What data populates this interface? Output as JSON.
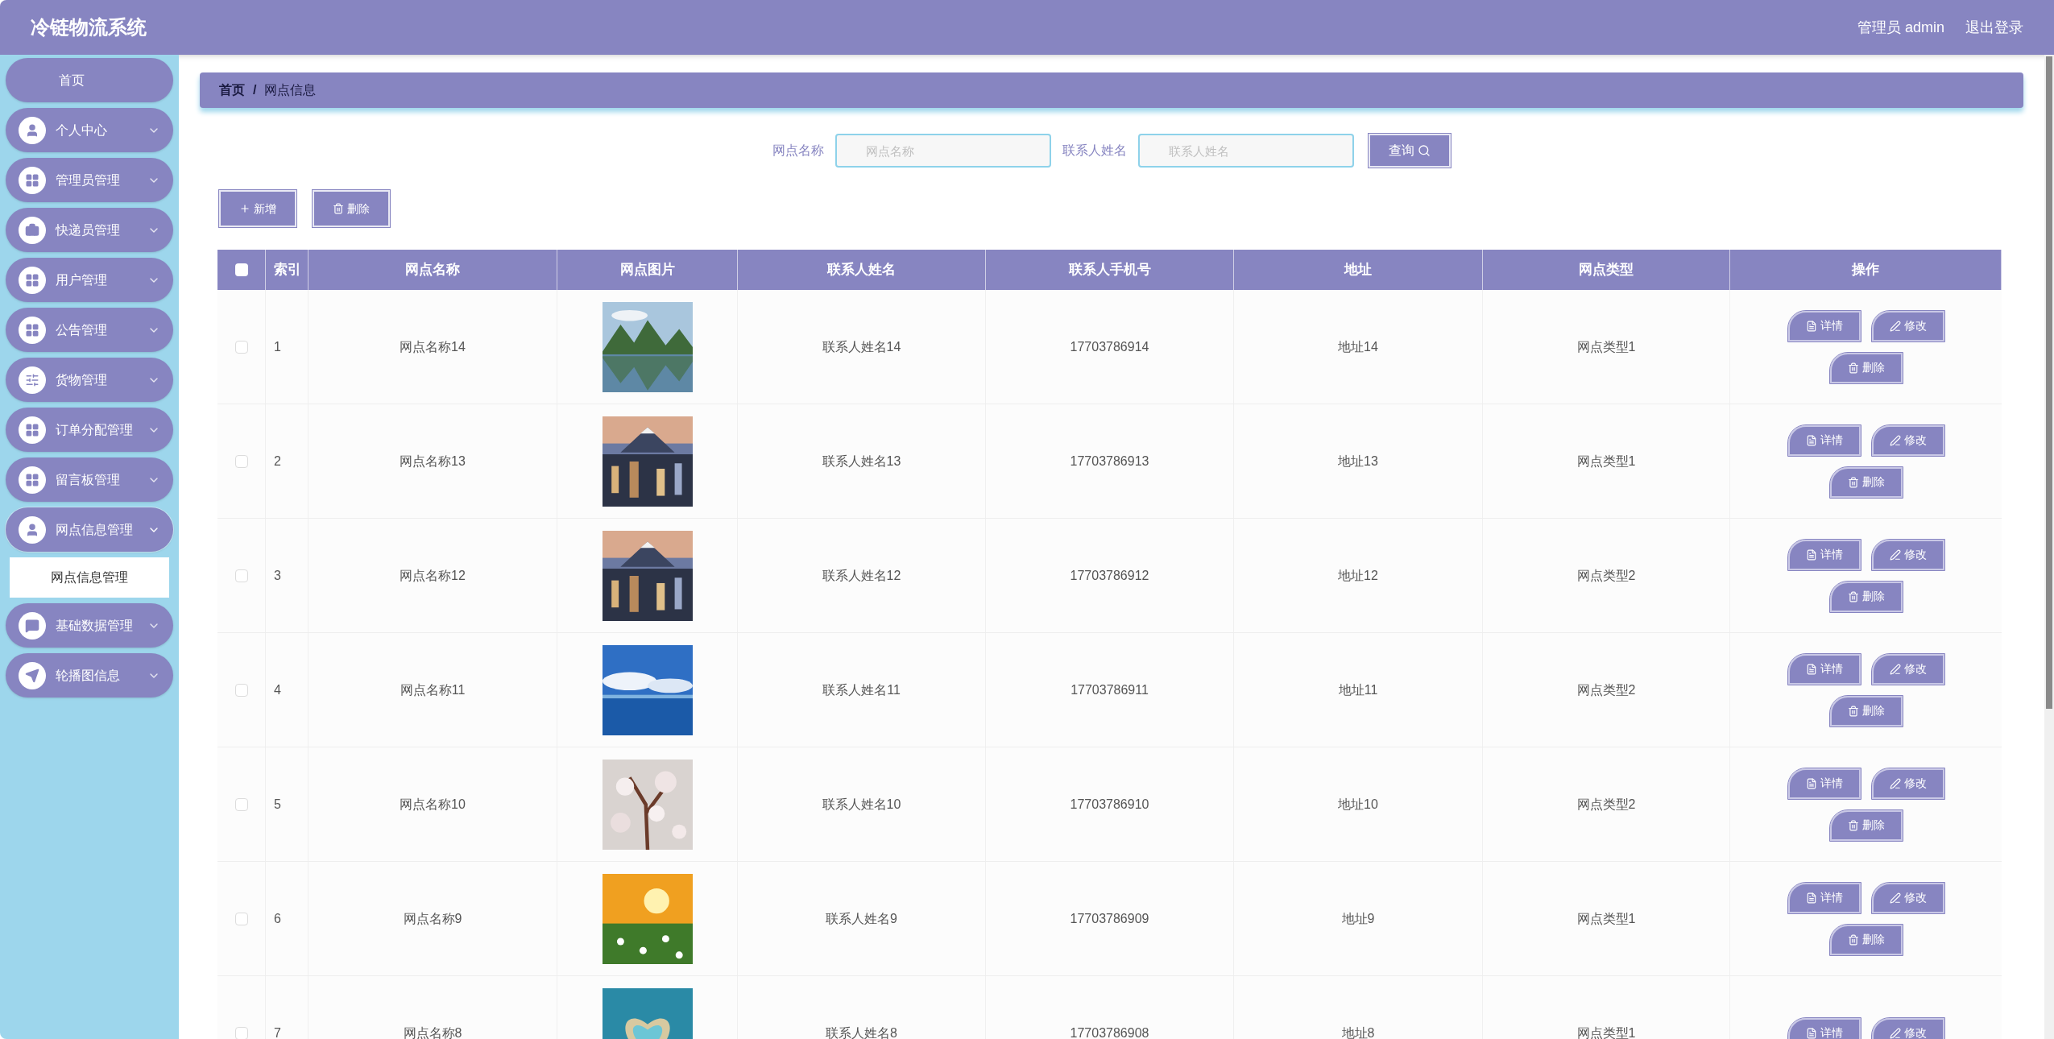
{
  "header": {
    "title": "冷链物流系统",
    "user": "管理员 admin",
    "logout": "退出登录"
  },
  "sidebar": {
    "items": [
      {
        "kind": "link",
        "label": "首页"
      },
      {
        "kind": "menu",
        "label": "个人中心",
        "expanded": false
      },
      {
        "kind": "menu",
        "label": "管理员管理",
        "expanded": false
      },
      {
        "kind": "menu",
        "label": "快递员管理",
        "expanded": false
      },
      {
        "kind": "menu",
        "label": "用户管理",
        "expanded": false
      },
      {
        "kind": "menu",
        "label": "公告管理",
        "expanded": false
      },
      {
        "kind": "menu",
        "label": "货物管理",
        "expanded": false
      },
      {
        "kind": "menu",
        "label": "订单分配管理",
        "expanded": false
      },
      {
        "kind": "menu",
        "label": "留言板管理",
        "expanded": false
      },
      {
        "kind": "menu",
        "label": "网点信息管理",
        "expanded": true,
        "children": [
          {
            "label": "网点信息管理",
            "selected": true
          }
        ]
      },
      {
        "kind": "menu",
        "label": "基础数据管理",
        "expanded": false
      },
      {
        "kind": "menu",
        "label": "轮播图信息",
        "expanded": false
      }
    ]
  },
  "breadcrumb": [
    "首页",
    "/",
    "网点信息"
  ],
  "search": {
    "fields": [
      {
        "label": "网点名称",
        "placeholder": "网点名称"
      },
      {
        "label": "联系人姓名",
        "placeholder": "联系人姓名"
      }
    ],
    "button": "查询"
  },
  "actions": [
    "新增",
    "删除"
  ],
  "table": {
    "columns": [
      "索引",
      "网点名称",
      "网点图片",
      "联系人姓名",
      "联系人手机号",
      "地址",
      "网点类型",
      "操作"
    ],
    "header_checked": false,
    "rows": [
      {
        "checked": false,
        "index": "1",
        "name": "网点名称14",
        "contact": "联系人姓名14",
        "phone": "17703786914",
        "address": "地址14",
        "type": "网点类型1",
        "actions": [
          "详情",
          "修改",
          "删除"
        ]
      },
      {
        "checked": false,
        "index": "2",
        "name": "网点名称13",
        "contact": "联系人姓名13",
        "phone": "17703786913",
        "address": "地址13",
        "type": "网点类型1",
        "actions": [
          "详情",
          "修改",
          "删除"
        ]
      },
      {
        "checked": false,
        "index": "3",
        "name": "网点名称12",
        "contact": "联系人姓名12",
        "phone": "17703786912",
        "address": "地址12",
        "type": "网点类型2",
        "actions": [
          "详情",
          "修改",
          "删除"
        ]
      },
      {
        "checked": false,
        "index": "4",
        "name": "网点名称11",
        "contact": "联系人姓名11",
        "phone": "17703786911",
        "address": "地址11",
        "type": "网点类型2",
        "actions": [
          "详情",
          "修改",
          "删除"
        ]
      },
      {
        "checked": false,
        "index": "5",
        "name": "网点名称10",
        "contact": "联系人姓名10",
        "phone": "17703786910",
        "address": "地址10",
        "type": "网点类型2",
        "actions": [
          "详情",
          "修改",
          "删除"
        ]
      },
      {
        "checked": false,
        "index": "6",
        "name": "网点名称9",
        "contact": "联系人姓名9",
        "phone": "17703786909",
        "address": "地址9",
        "type": "网点类型1",
        "actions": [
          "详情",
          "修改",
          "删除"
        ]
      },
      {
        "checked": false,
        "index": "7",
        "name": "网点名称8",
        "contact": "联系人姓名8",
        "phone": "17703786908",
        "address": "地址8",
        "type": "网点类型1",
        "actions": [
          "详情",
          "修改"
        ]
      }
    ]
  }
}
